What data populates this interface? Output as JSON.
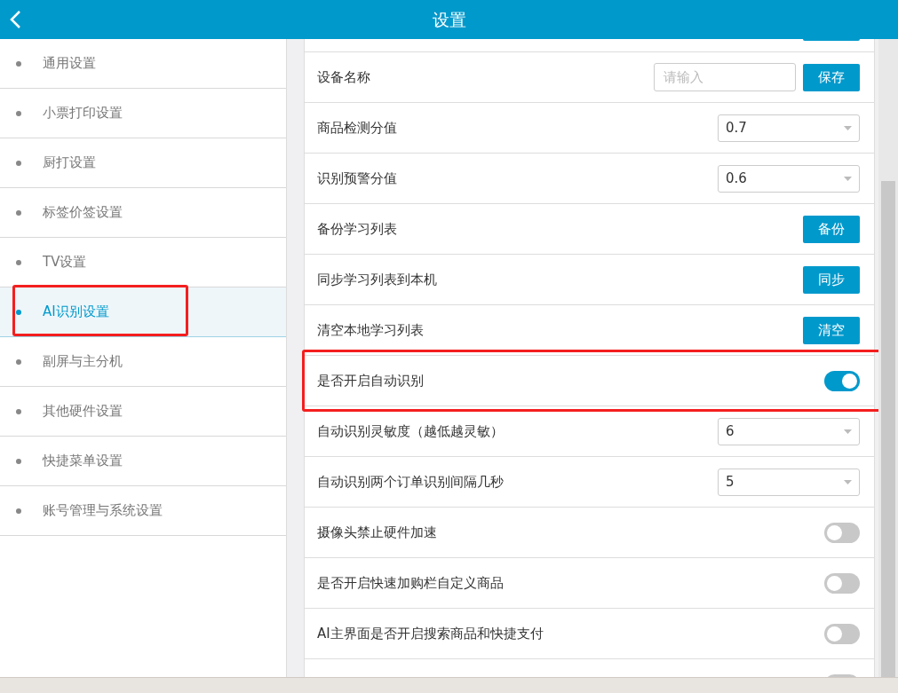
{
  "header": {
    "title": "设置"
  },
  "sidebar": {
    "items": [
      {
        "label": "通用设置",
        "selected": false,
        "highlighted": false
      },
      {
        "label": "小票打印设置",
        "selected": false,
        "highlighted": false
      },
      {
        "label": "厨打设置",
        "selected": false,
        "highlighted": false
      },
      {
        "label": "标签价签设置",
        "selected": false,
        "highlighted": false
      },
      {
        "label": "TV设置",
        "selected": false,
        "highlighted": false
      },
      {
        "label": "AI识别设置",
        "selected": true,
        "highlighted": true
      },
      {
        "label": "副屏与主分机",
        "selected": false,
        "highlighted": false
      },
      {
        "label": "其他硬件设置",
        "selected": false,
        "highlighted": false
      },
      {
        "label": "快捷菜单设置",
        "selected": false,
        "highlighted": false
      },
      {
        "label": "账号管理与系统设置",
        "selected": false,
        "highlighted": false
      }
    ]
  },
  "settings": [
    {
      "kind": "partial",
      "highlighted": false
    },
    {
      "kind": "input",
      "label": "设备名称",
      "placeholder": "请输入",
      "button": "保存",
      "highlighted": false
    },
    {
      "kind": "select",
      "label": "商品检测分值",
      "value": "0.7",
      "highlighted": false
    },
    {
      "kind": "select",
      "label": "识别预警分值",
      "value": "0.6",
      "highlighted": false
    },
    {
      "kind": "button",
      "label": "备份学习列表",
      "button": "备份",
      "highlighted": false
    },
    {
      "kind": "button",
      "label": "同步学习列表到本机",
      "button": "同步",
      "highlighted": false
    },
    {
      "kind": "button",
      "label": "清空本地学习列表",
      "button": "清空",
      "highlighted": false
    },
    {
      "kind": "toggle",
      "label": "是否开启自动识别",
      "on": true,
      "highlighted": true
    },
    {
      "kind": "select",
      "label": "自动识别灵敏度（越低越灵敏）",
      "value": "6",
      "highlighted": false
    },
    {
      "kind": "select",
      "label": "自动识别两个订单识别间隔几秒",
      "value": "5",
      "highlighted": false
    },
    {
      "kind": "toggle",
      "label": "摄像头禁止硬件加速",
      "on": false,
      "highlighted": false
    },
    {
      "kind": "toggle",
      "label": "是否开启快速加购栏自定义商品",
      "on": false,
      "highlighted": false
    },
    {
      "kind": "toggle",
      "label": "AI主界面是否开启搜索商品和快捷支付",
      "on": false,
      "highlighted": false
    },
    {
      "kind": "toggle",
      "on": false,
      "highlighted": false
    }
  ]
}
